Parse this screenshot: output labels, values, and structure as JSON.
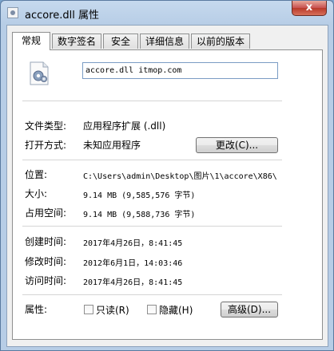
{
  "window": {
    "title": "accore.dll 属性",
    "close_label": "x"
  },
  "tabs": [
    {
      "label": "常规",
      "active": true
    },
    {
      "label": "数字签名",
      "active": false
    },
    {
      "label": "安全",
      "active": false
    },
    {
      "label": "详细信息",
      "active": false
    },
    {
      "label": "以前的版本",
      "active": false
    }
  ],
  "general": {
    "file_icon": "dll-gear-file-icon",
    "file_name": "accore.dll itmop.com",
    "file_type_label": "文件类型:",
    "file_type_value": "应用程序扩展 (.dll)",
    "opens_with_label": "打开方式:",
    "opens_with_value": "未知应用程序",
    "change_button": "更改(C)...",
    "location_label": "位置:",
    "location_value": "C:\\Users\\admin\\Desktop\\图片\\1\\accore\\X86\\",
    "size_label": "大小:",
    "size_value": "9.14 MB (9,585,576 字节)",
    "size_on_disk_label": "占用空间:",
    "size_on_disk_value": "9.14 MB (9,588,736 字节)",
    "created_label": "创建时间:",
    "created_value": "2017年4月26日，8:41:45",
    "modified_label": "修改时间:",
    "modified_value": "2012年6月1日，14:03:46",
    "accessed_label": "访问时间:",
    "accessed_value": "2017年4月26日，8:41:45",
    "attributes_label": "属性:",
    "readonly_label": "只读(R)",
    "readonly_checked": false,
    "hidden_label": "隐藏(H)",
    "hidden_checked": false,
    "advanced_button": "高级(D)..."
  },
  "colors": {
    "accent_border": "#7a9cc4",
    "close_red": "#c75050"
  }
}
